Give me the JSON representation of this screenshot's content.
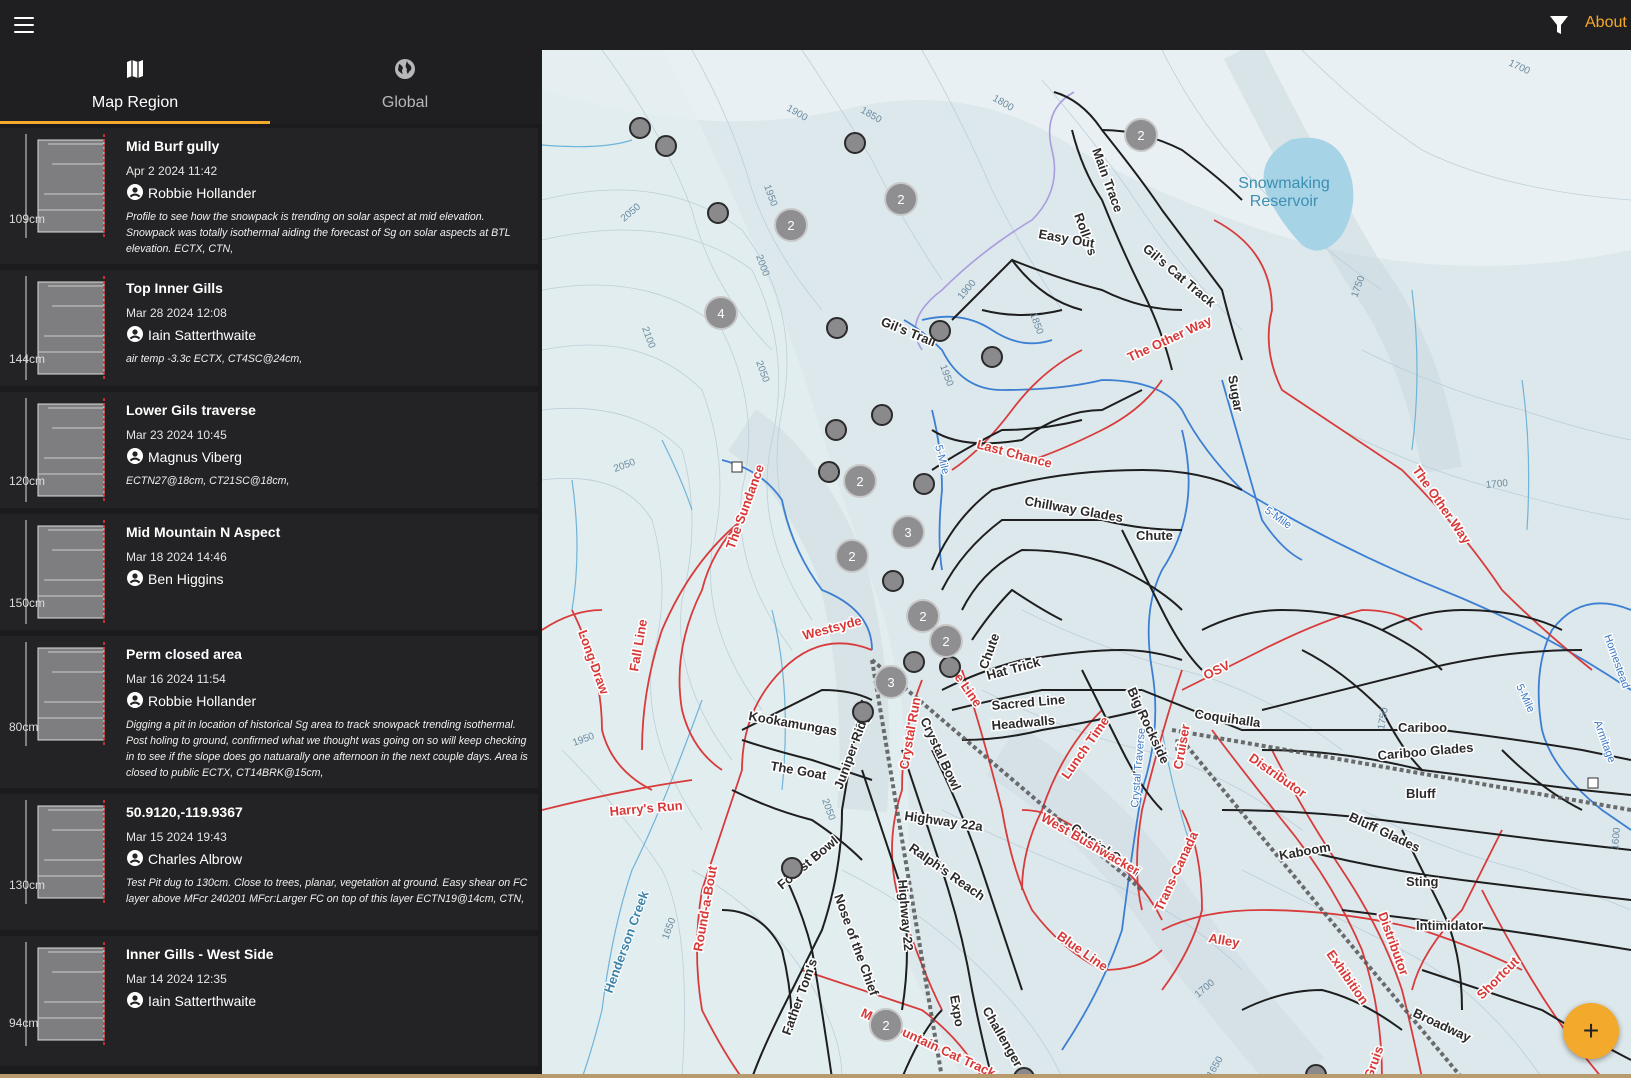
{
  "header": {
    "menu_icon": "hamburger-menu-icon",
    "filter_icon": "filter-funnel-icon",
    "about_label": "About",
    "accent_color": "#f3a92b"
  },
  "tabs": [
    {
      "label": "Map Region",
      "icon": "map-icon",
      "active": true
    },
    {
      "label": "Global",
      "icon": "globe-icon",
      "active": false
    }
  ],
  "observations": [
    {
      "title": "Mid Burf gully",
      "date": "Apr 2 2024 11:42",
      "user": "Robbie Hollander",
      "depth": "109cm",
      "note": "Profile to see how the snowpack is trending on solar aspect at mid elevation. Snowpack was totally isothermal aiding the forecast of Sg on solar aspects at BTL elevation.  ECTX, CTN,"
    },
    {
      "title": "Top Inner Gills",
      "date": "Mar 28 2024 12:08",
      "user": "Iain Satterthwaite",
      "depth": "144cm",
      "note": "air temp -3.3c ECTX, CT4SC@24cm,"
    },
    {
      "title": "Lower Gils traverse",
      "date": "Mar 23 2024 10:45",
      "user": "Magnus Viberg",
      "depth": "120cm",
      "note": " ECTN27@18cm, CT21SC@18cm,"
    },
    {
      "title": "Mid Mountain N Aspect",
      "date": "Mar 18 2024 14:46",
      "user": "Ben Higgins",
      "depth": "150cm",
      "note": ""
    },
    {
      "title": "Perm closed area",
      "date": "Mar 16 2024 11:54",
      "user": "Robbie Hollander",
      "depth": "80cm",
      "note": "Digging a pit in location of historical Sg  area to track snowpack trending isothermal. Post holing to ground, confirmed what we thought was going on so will keep checking in to see if the slope does go natuarally one afternoon in the next couple days. Area is closed to public  ECTX, CT14BRK@15cm,"
    },
    {
      "title": "50.9120,-119.9367",
      "date": "Mar 15 2024 19:43",
      "user": "Charles Albrow",
      "depth": "130cm",
      "note": "Test Pit dug to 130cm. Close to trees, planar, vegetation at  ground. Easy shear on FC layer above MFcr 240201 MFcr:Larger FC on top of this layer  ECTN19@14cm, CTN,"
    },
    {
      "title": "Inner Gills - West Side",
      "date": "Mar 14 2024 12:35",
      "user": "Iain Satterthwaite",
      "depth": "94cm",
      "note": ""
    }
  ],
  "map": {
    "lake_label": [
      "Snowmaking",
      "Reservoir"
    ],
    "creek_label": "Henderson Creek",
    "run_labels_black": [
      "Main Trace",
      "Rollers",
      "Easy Out",
      "Gil's Cat Track",
      "Gil's Trail",
      "Chillway Glades",
      "Chute",
      "Hat Trick",
      "Sacred Line",
      "Headwalls",
      "Kookamungas",
      "Juniper Ridge",
      "Crystal Bowl",
      "The Goat",
      "Highway 22a",
      "Ralph's Reach",
      "Crystal Quad",
      "Coquihalla",
      "Cariboo",
      "Cariboo Glades",
      "Bluff",
      "Bluff Glades",
      "Sting",
      "Intimidator",
      "Kaboom",
      "Broadway",
      "Forest Bowl",
      "Nose of the Chief",
      "Father Tom's",
      "Highway 22",
      "Challenger",
      "Expo",
      "Big Rockside",
      "Chute",
      "Sugar"
    ],
    "run_labels_red": [
      "The Other Way",
      "Last Chance",
      "The Other Way",
      "The Sundance",
      "Westsyde",
      "Long Draw",
      "Fall Line",
      "Harry's Run",
      "Blue Line",
      "Lunch Time",
      "West Bushwacker",
      "Crystal Run",
      "Trans-Canada",
      "Alley",
      "OSV",
      "Cruiser",
      "Distributor",
      "Distributor",
      "Exhibition",
      "Shortcut",
      "Round-a-Bout",
      "Mid-Mountain Cat Track",
      "Blue Line",
      "Gruis"
    ],
    "run_labels_blue": [
      "5-Mile",
      "5-Mile",
      "5-Mile",
      "Homestead",
      "Armitage",
      "Crystal Traverse"
    ],
    "contours": [
      "1700",
      "1800",
      "1850",
      "1900",
      "1950",
      "2000",
      "2050",
      "2100",
      "2050",
      "2050",
      "1750",
      "1700",
      "1850",
      "1900",
      "1950",
      "1950",
      "2050",
      "1650",
      "1700",
      "1750",
      "1600",
      "1650"
    ],
    "cluster_markers": [
      {
        "count": "2"
      },
      {
        "count": "2"
      },
      {
        "count": "2"
      },
      {
        "count": "4"
      },
      {
        "count": "2"
      },
      {
        "count": "3"
      },
      {
        "count": "2"
      },
      {
        "count": "2"
      },
      {
        "count": "2"
      },
      {
        "count": "3"
      },
      {
        "count": "2"
      }
    ],
    "add_button_icon": "plus-icon"
  }
}
